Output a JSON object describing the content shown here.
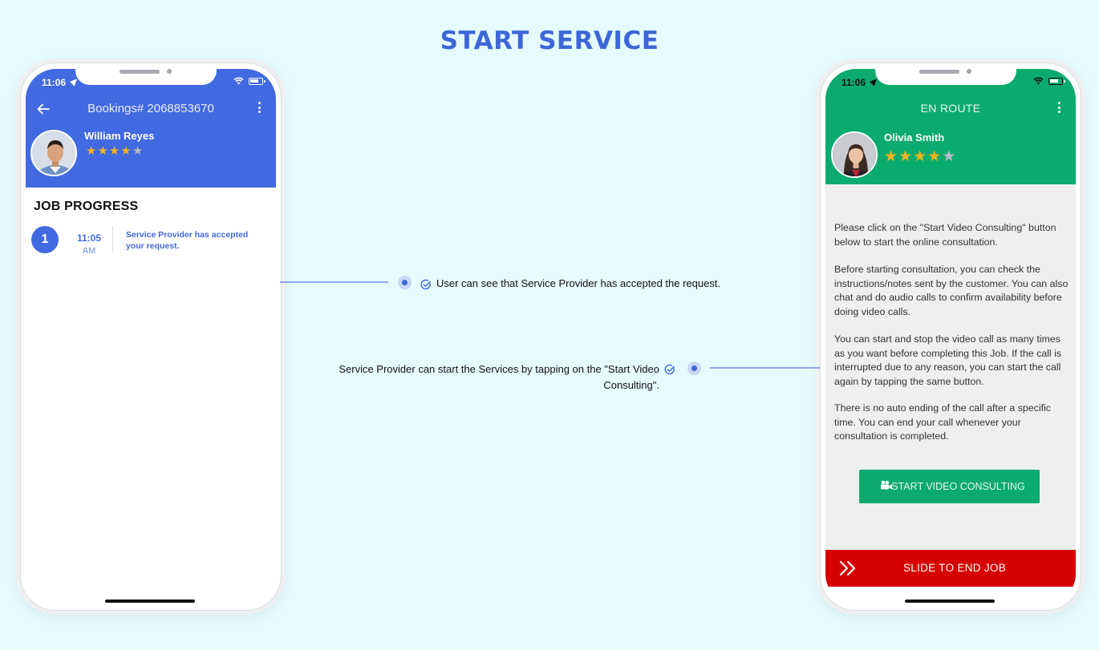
{
  "page": {
    "title": "START SERVICE"
  },
  "left_phone": {
    "status_time": "11:06",
    "header_title": "Bookings# 2068853670",
    "user_name": "William Reyes",
    "rating": 4,
    "job_progress_label": "JOB PROGRESS",
    "steps": [
      {
        "number": "1",
        "time": "11:05",
        "ampm": "AM",
        "text": "Service Provider has accepted your request."
      }
    ]
  },
  "right_phone": {
    "status_time": "11:06",
    "header_title": "EN ROUTE",
    "user_name": "Olivia Smith",
    "rating": 4,
    "paragraphs": [
      "Please click on the \"Start Video Consulting\" button below to start the online consultation.",
      "Before starting consultation, you can check the instructions/notes sent by the customer. You can also chat and do audio calls to confirm availability before doing video calls.",
      "You can start and stop the video call as many times as you want before completing this Job. If the call is interrupted due to any reason, you can start the call again by tapping the same button.",
      "There is no auto ending of the call after a specific time. You can end your call whenever your consultation is completed."
    ],
    "cta_label": "START VIDEO CONSULTING",
    "slide_label": "SLIDE TO END JOB"
  },
  "annotations": {
    "user_note": "User can see that Service Provider has accepted the request.",
    "provider_note_line1": "Service Provider can start the Services by tapping on the \"Start Video",
    "provider_note_line2": "Consulting\"."
  },
  "colors": {
    "title_blue": "#3d67d9",
    "header_blue": "#4169e1",
    "header_green": "#0bab6f",
    "slide_red": "#d60000",
    "star": "#f6b51d",
    "background": "#e6fbfd"
  },
  "icons": [
    "back-arrow-icon",
    "kebab-menu-icon",
    "location-arrow-icon",
    "wifi-icon",
    "battery-icon",
    "star-icon",
    "video-camera-icon",
    "double-chevron-right-icon",
    "check-circle-icon"
  ]
}
